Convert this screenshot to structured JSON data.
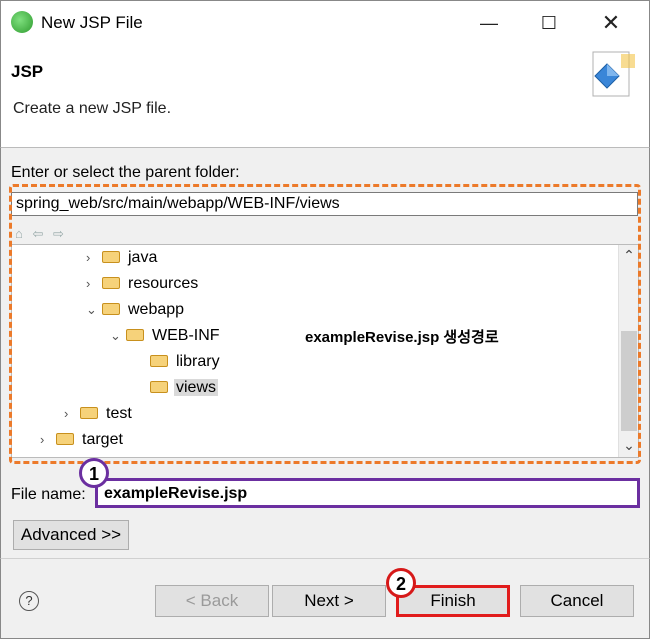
{
  "window": {
    "title": "New JSP File",
    "controls": {
      "minimize": "—",
      "maximize": "☐",
      "close": "✕"
    }
  },
  "banner": {
    "title": "JSP",
    "description": "Create a new JSP file."
  },
  "folder_section": {
    "label": "Enter or select the parent folder:",
    "path_value": "spring_web/src/main/webapp/WEB-INF/views",
    "toolbar_icons": [
      "home-icon",
      "back-arrow-icon",
      "forward-arrow-icon"
    ],
    "tree": [
      {
        "label": "java",
        "twisty": "›",
        "selected": false
      },
      {
        "label": "resources",
        "twisty": "›",
        "selected": false
      },
      {
        "label": "webapp",
        "twisty": "⌄",
        "selected": false
      },
      {
        "label": "WEB-INF",
        "twisty": "⌄",
        "selected": false
      },
      {
        "label": "library",
        "twisty": "",
        "selected": false
      },
      {
        "label": "views",
        "twisty": "",
        "selected": true
      },
      {
        "label": "test",
        "twisty": "›",
        "selected": false
      },
      {
        "label": "target",
        "twisty": "›",
        "selected": false
      }
    ],
    "annotation": "exampleRevise.jsp 생성경로"
  },
  "filename": {
    "label": "File name:",
    "value": "exampleRevise.jsp"
  },
  "advanced_label": "Advanced >>",
  "markers": {
    "one": "1",
    "two": "2"
  },
  "footer": {
    "help": "?",
    "back": "< Back",
    "next": "Next >",
    "finish": "Finish",
    "cancel": "Cancel"
  },
  "colors": {
    "folder_box": "#ec7a2a",
    "filename_highlight": "#6b2fa0",
    "finish_highlight": "#e11c1c"
  }
}
